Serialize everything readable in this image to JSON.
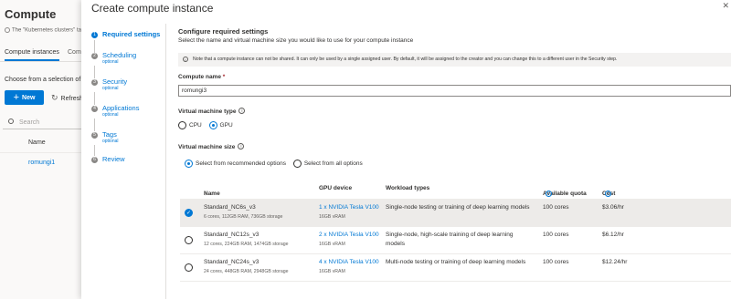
{
  "background": {
    "title": "Compute",
    "info_text": "The \"Kubernetes clusters\" tab",
    "tabs": [
      "Compute instances",
      "Comp"
    ],
    "choose_text": "Choose from a selection of Cl",
    "new_button": "New",
    "refresh_button": "Refresh",
    "search_placeholder": "Search",
    "name_header": "Name",
    "row_name": "romungi1"
  },
  "panel": {
    "title": "Create compute instance",
    "steps": [
      {
        "label": "Required settings",
        "sub": ""
      },
      {
        "label": "Scheduling",
        "sub": "optional"
      },
      {
        "label": "Security",
        "sub": "optional"
      },
      {
        "label": "Applications",
        "sub": "optional"
      },
      {
        "label": "Tags",
        "sub": "optional"
      },
      {
        "label": "Review",
        "sub": ""
      }
    ],
    "section_title": "Configure required settings",
    "section_desc": "Select the name and virtual machine size you would like to use for your compute instance",
    "notice": "Note that a compute instance can not be shared. It can only be used by a single assigned user. By default, it will be assigned to the creator and you can change this to a different user in the Security step.",
    "compute_name_label": "Compute name",
    "compute_name_required": "*",
    "compute_name_value": "romungi3",
    "vm_type_label": "Virtual machine type",
    "vm_type_options": [
      "CPU",
      "GPU"
    ],
    "vm_size_label": "Virtual machine size",
    "vm_size_options": [
      "Select from recommended options",
      "Select from all options"
    ],
    "table": {
      "headers": [
        "Name",
        "GPU device",
        "Workload types",
        "Available quota",
        "Cost"
      ],
      "sort_indicator": "↑",
      "rows": [
        {
          "name": "Standard_NC6s_v3",
          "specs": "6 cores, 112GB RAM, 736GB storage",
          "gpu": "1 x NVIDIA Tesla V100",
          "vram": "16GB vRAM",
          "workload": "Single-node testing or training of deep learning models",
          "workload2": "",
          "quota": "100 cores",
          "cost": "$3.06/hr"
        },
        {
          "name": "Standard_NC12s_v3",
          "specs": "12 cores, 224GB RAM, 1474GB storage",
          "gpu": "2 x NVIDIA Tesla V100",
          "vram": "16GB vRAM",
          "workload": "Single-node, high-scale training of deep learning",
          "workload2": "models",
          "quota": "100 cores",
          "cost": "$6.12/hr"
        },
        {
          "name": "Standard_NC24s_v3",
          "specs": "24 cores, 448GB RAM, 2948GB storage",
          "gpu": "4 x NVIDIA Tesla V100",
          "vram": "16GB vRAM",
          "workload": "Multi-node testing or training of deep learning models",
          "workload2": "",
          "quota": "100 cores",
          "cost": "$12.24/hr"
        }
      ]
    }
  }
}
